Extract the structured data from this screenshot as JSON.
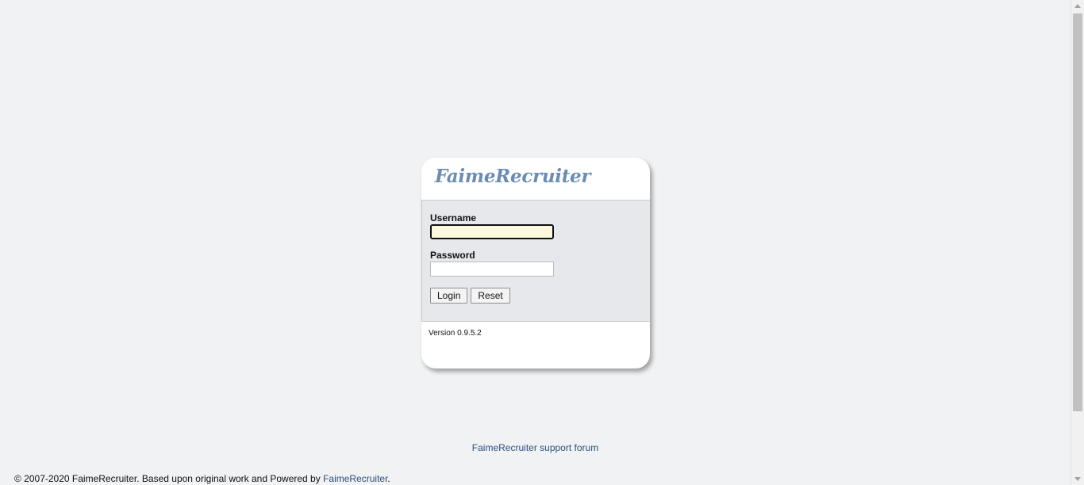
{
  "app": {
    "logo_text": "FaimeRecruiter"
  },
  "login_form": {
    "username_label": "Username",
    "username_value": "",
    "password_label": "Password",
    "password_value": "",
    "login_button": "Login",
    "reset_button": "Reset"
  },
  "version_text": "Version 0.9.5.2",
  "support_link_text": "FaimeRecruiter support forum",
  "footer": {
    "copyright_text": "© 2007-2020 FaimeRecruiter. Based upon original work and Powered by ",
    "powered_link_text": "FaimeRecruiter",
    "trailing_text": "."
  },
  "colors": {
    "background": "#f1f2f4",
    "logo": "#6b8db3",
    "link": "#2d4f7c",
    "focused_input_bg": "#fbf8dd"
  }
}
